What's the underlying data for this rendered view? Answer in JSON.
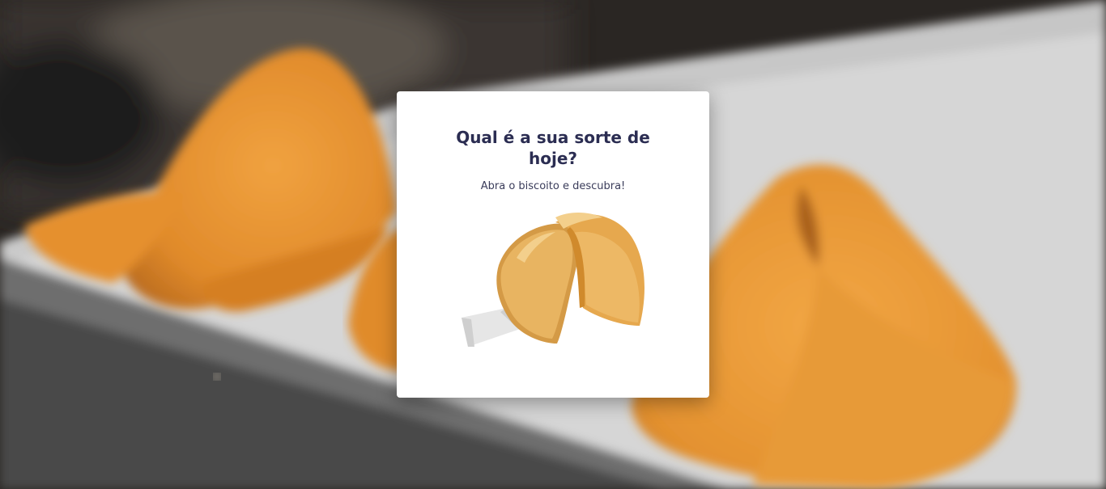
{
  "card": {
    "title": "Qual é a sua sorte de hoje?",
    "subtitle": "Abra o biscoito e descubra!",
    "cookie_icon": "fortune-cookie-icon"
  },
  "colors": {
    "title": "#2b2d52",
    "cookie": "#e9b35f",
    "cookie_shadow": "#d79a3c",
    "paper": "#e6e6e6",
    "card_bg": "#ffffff"
  }
}
